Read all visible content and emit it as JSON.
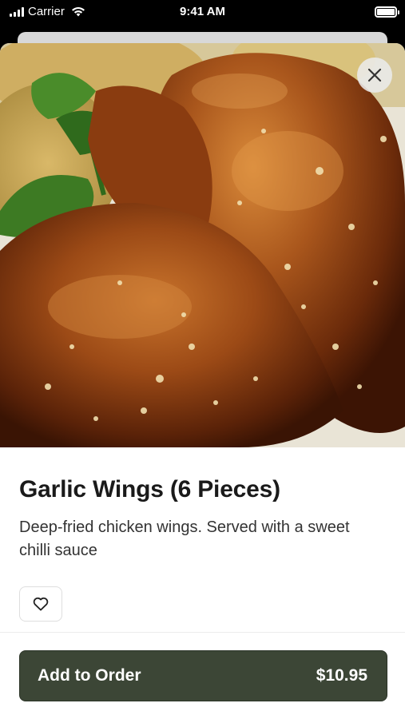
{
  "status_bar": {
    "carrier": "Carrier",
    "time": "9:41 AM"
  },
  "item": {
    "title": "Garlic Wings (6 Pieces)",
    "description": "Deep-fried chicken wings. Served with a sweet chilli sauce",
    "image_alt": "garlic-wings-photo"
  },
  "actions": {
    "add_label": "Add to Order",
    "price": "$10.95"
  },
  "icons": {
    "close": "close-icon",
    "favorite": "heart-icon"
  },
  "colors": {
    "primary_button": "#3c4636",
    "text": "#1a1a1a"
  }
}
